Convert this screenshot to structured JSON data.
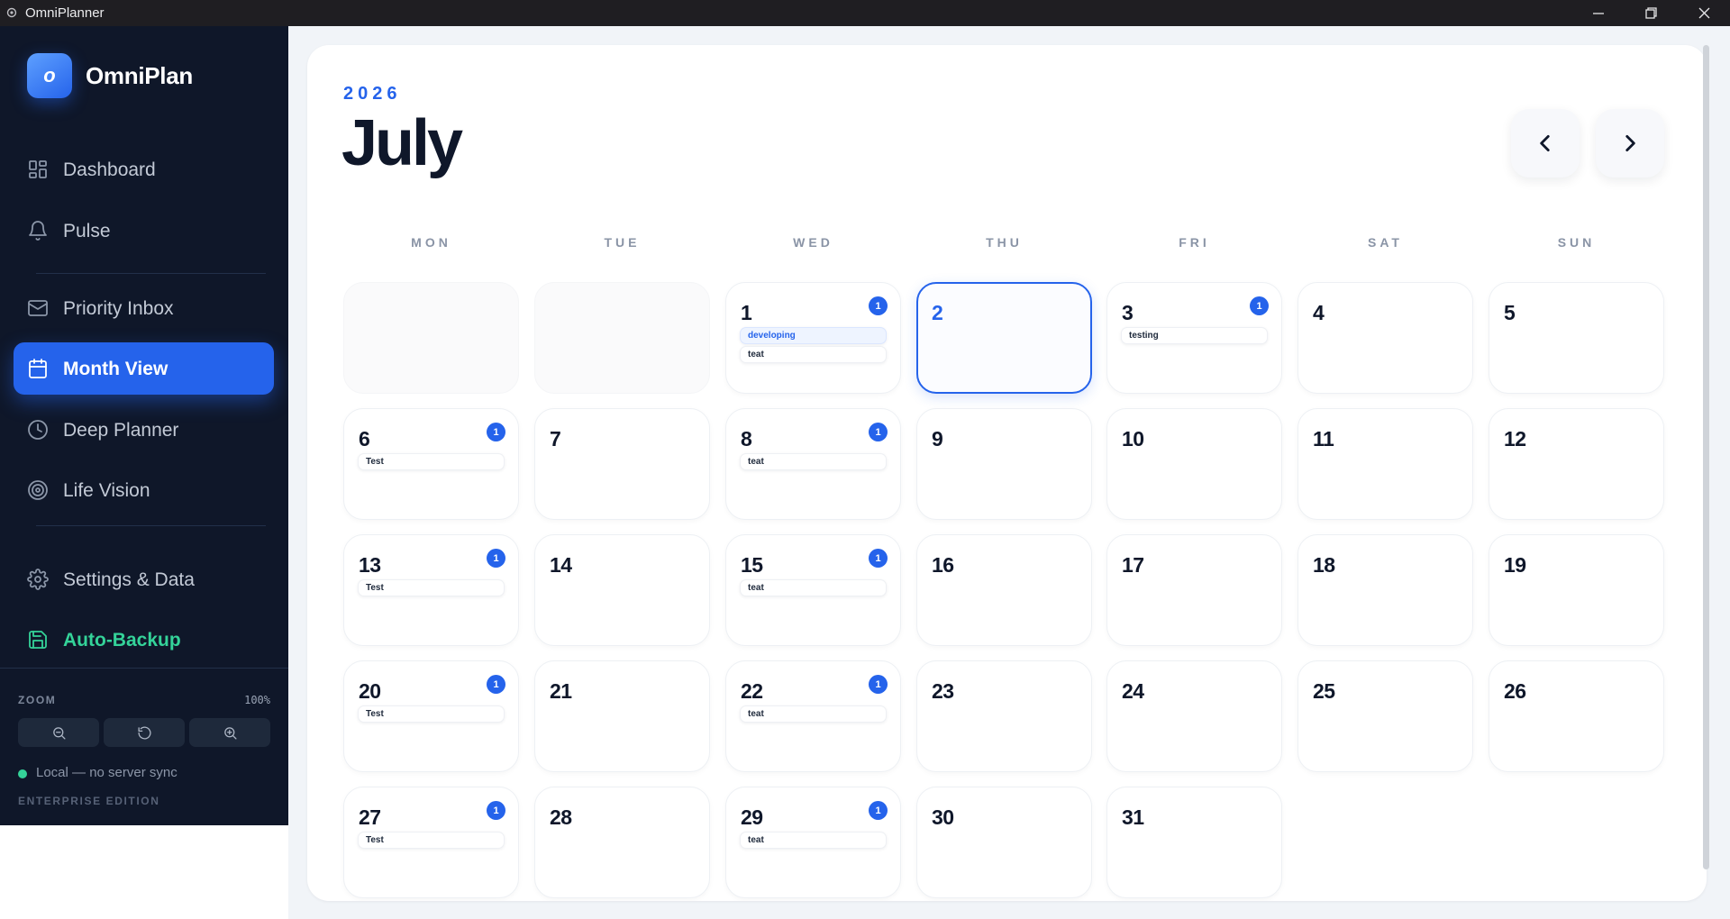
{
  "window": {
    "title": "OmniPlanner"
  },
  "sidebar": {
    "logo_letter": "o",
    "brand": "OmniPlan",
    "items": [
      {
        "label": "Dashboard",
        "icon": "dashboard-icon"
      },
      {
        "label": "Pulse",
        "icon": "bell-icon"
      },
      {
        "label": "Priority Inbox",
        "icon": "mail-icon"
      },
      {
        "label": "Month View",
        "icon": "calendar-icon",
        "active": true
      },
      {
        "label": "Deep Planner",
        "icon": "clock-icon"
      },
      {
        "label": "Life Vision",
        "icon": "target-icon"
      },
      {
        "label": "Settings & Data",
        "icon": "gear-icon"
      },
      {
        "label": "Auto-Backup",
        "icon": "save-icon"
      }
    ],
    "zoom": {
      "label": "ZOOM",
      "value": "100%"
    },
    "sync_status": "Local — no server sync",
    "edition": "ENTERPRISE EDITION"
  },
  "calendar": {
    "year": "2026",
    "month": "July",
    "today": 2,
    "weekdays": [
      "MON",
      "TUE",
      "WED",
      "THU",
      "FRI",
      "SAT",
      "SUN"
    ],
    "leading_blanks": 2,
    "days": [
      {
        "d": "1",
        "badge": "1",
        "events": [
          "developing",
          "teat"
        ],
        "highlight": [
          0
        ]
      },
      {
        "d": "2",
        "events": []
      },
      {
        "d": "3",
        "badge": "1",
        "events": [
          "testing"
        ]
      },
      {
        "d": "4",
        "events": []
      },
      {
        "d": "5",
        "events": []
      },
      {
        "d": "6",
        "badge": "1",
        "events": [
          "Test"
        ]
      },
      {
        "d": "7",
        "events": []
      },
      {
        "d": "8",
        "badge": "1",
        "events": [
          "teat"
        ]
      },
      {
        "d": "9",
        "events": []
      },
      {
        "d": "10",
        "events": []
      },
      {
        "d": "11",
        "events": []
      },
      {
        "d": "12",
        "events": []
      },
      {
        "d": "13",
        "badge": "1",
        "events": [
          "Test"
        ]
      },
      {
        "d": "14",
        "events": []
      },
      {
        "d": "15",
        "badge": "1",
        "events": [
          "teat"
        ]
      },
      {
        "d": "16",
        "events": []
      },
      {
        "d": "17",
        "events": []
      },
      {
        "d": "18",
        "events": []
      },
      {
        "d": "19",
        "events": []
      },
      {
        "d": "20",
        "badge": "1",
        "events": [
          "Test"
        ]
      },
      {
        "d": "21",
        "events": []
      },
      {
        "d": "22",
        "badge": "1",
        "events": [
          "teat"
        ]
      },
      {
        "d": "23",
        "events": []
      },
      {
        "d": "24",
        "events": []
      },
      {
        "d": "25",
        "events": []
      },
      {
        "d": "26",
        "events": []
      },
      {
        "d": "27",
        "badge": "1",
        "events": [
          "Test"
        ]
      },
      {
        "d": "28",
        "events": []
      },
      {
        "d": "29",
        "badge": "1",
        "events": [
          "teat"
        ]
      },
      {
        "d": "30",
        "events": []
      },
      {
        "d": "31",
        "events": []
      }
    ]
  },
  "colors": {
    "accent": "#2563eb",
    "sidebar_bg": "#0f1729",
    "success": "#34d399",
    "text_dark": "#0f172a"
  }
}
